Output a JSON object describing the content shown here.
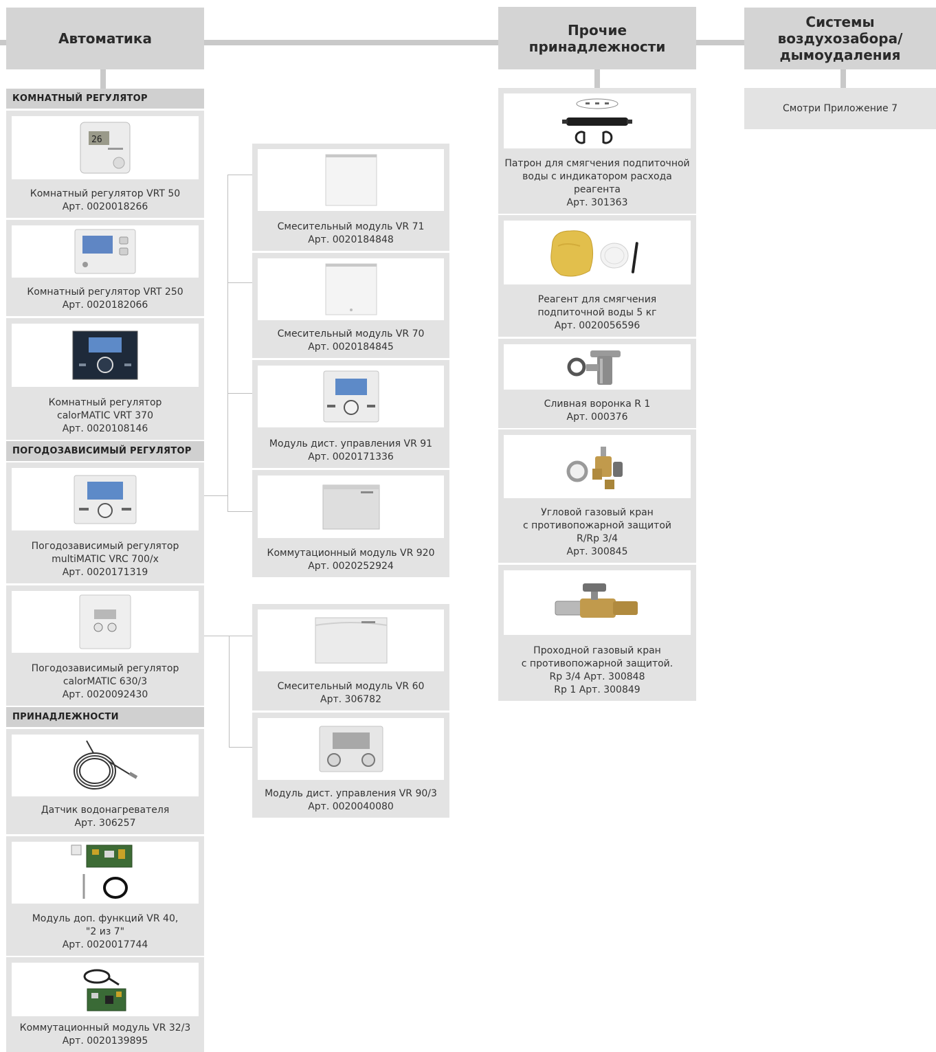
{
  "headers": {
    "automation": "Автоматика",
    "other_accessories": "Прочие\nпринадлежности",
    "flue_systems": "Системы\nвоздухозабора/\nдымоудаления"
  },
  "flue_note": "Смотри Приложение 7",
  "sections": {
    "room_controllers": "КОМНАТНЫЙ РЕГУЛЯТОР",
    "weather_controllers": "ПОГОДОЗАВИСИМЫЙ РЕГУЛЯТОР",
    "accessories": "ПРИНАДЛЕЖНОСТИ"
  },
  "left_items": [
    {
      "lines": [
        "Комнатный регулятор VRT 50",
        "Арт. 0020018266"
      ],
      "icon": "room-thermostat-display-icon"
    },
    {
      "lines": [
        "Комнатный регулятор VRT 250",
        "Арт. 0020182066"
      ],
      "icon": "room-thermostat-blue-display-icon"
    },
    {
      "lines": [
        "Комнатный регулятор",
        "calorMATIC VRT 370",
        "Арт. 0020108146"
      ],
      "icon": "dark-controller-knob-icon"
    },
    {
      "lines": [
        "Погодозависимый регулятор",
        "multiMATIC VRC 700/x",
        "Арт. 0020171319"
      ],
      "icon": "weather-controller-knob-icon"
    },
    {
      "lines": [
        "Погодозависимый регулятор",
        "calorMATIC 630/3",
        "Арт. 0020092430"
      ],
      "icon": "weather-controller-two-knobs-icon"
    },
    {
      "lines": [
        "Датчик водонагревателя",
        "Арт. 306257"
      ],
      "icon": "coiled-sensor-cable-icon"
    },
    {
      "lines": [
        "Модуль доп. функций VR 40,",
        "\"2 из 7\"",
        "Арт. 0020017744"
      ],
      "icon": "circuit-board-with-cable-icon"
    },
    {
      "lines": [
        "Коммутационный модуль VR 32/3",
        "Арт. 0020139895"
      ],
      "icon": "board-with-cable-icon"
    }
  ],
  "middle_items": [
    {
      "lines": [
        "Смесительный модуль VR 71",
        "Арт. 0020184848"
      ],
      "icon": "white-module-box-icon"
    },
    {
      "lines": [
        "Смесительный модуль VR 70",
        "Арт. 0020184845"
      ],
      "icon": "white-module-box-icon"
    },
    {
      "lines": [
        "Модуль дист. управления VR 91",
        "Арт. 0020171336"
      ],
      "icon": "remote-controller-knob-icon"
    },
    {
      "lines": [
        "Коммутационный модуль VR 920",
        "Арт. 0020252924"
      ],
      "icon": "grey-module-box-icon"
    },
    {
      "lines": [
        "Смесительный модуль VR 60",
        "Арт. 306782"
      ],
      "icon": "wide-module-box-icon"
    },
    {
      "lines": [
        "Модуль дист. управления VR 90/3",
        "Арт. 0020040080"
      ],
      "icon": "remote-controller-two-knobs-icon"
    }
  ],
  "right_items": [
    {
      "lines": [
        "Патрон для смягчения подпиточной",
        "воды с индикатором расхода",
        "реагента",
        "Арт. 301363"
      ],
      "icon": "softening-cartridge-icon"
    },
    {
      "lines": [
        "Реагент для смягчения",
        "подпиточной воды 5 кг",
        "Арт. 0020056596"
      ],
      "icon": "reagent-bag-icon"
    },
    {
      "lines": [
        "Сливная воронка R 1",
        "Арт. 000376"
      ],
      "icon": "drain-funnel-icon"
    },
    {
      "lines": [
        "Угловой газовый кран",
        "с противопожарной защитой",
        "R/Rp 3/4",
        "Арт. 300845"
      ],
      "icon": "angle-gas-valve-icon"
    },
    {
      "lines": [
        "Проходной газовый кран",
        "с противопожарной защитой.",
        "Rp 3/4 Арт. 300848",
        "Rp 1 Арт. 300849"
      ],
      "icon": "straight-gas-valve-icon"
    }
  ],
  "colors": {
    "header_bg": "#d4d4d4",
    "section_bg": "#d0d0d0",
    "card_bg": "#e3e3e3",
    "connector": "#c9c9c9",
    "text": "#2b2b2b"
  }
}
